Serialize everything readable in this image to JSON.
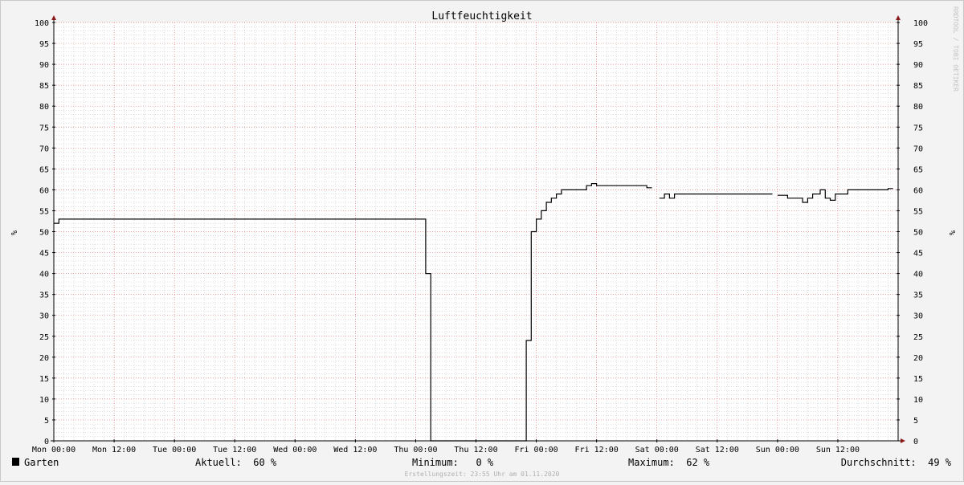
{
  "watermark": "RRDTOOL / TOBI OETIKER",
  "footer": "Erstellungszeit: 23:55 Uhr am 01.11.2020",
  "legend": {
    "series_name": "Garten",
    "current": "Aktuell:  60 %",
    "minimum": "Minimum:   0 %",
    "maximum": "Maximum:  62 %",
    "average": "Durchschnitt:  49 %"
  },
  "colors": {
    "line": "#000000",
    "major_grid": "#e07a7a",
    "minor_grid": "#bdbdbd",
    "background": "#ffffff",
    "canvas": "#f3f3f3",
    "axis_arrow": "#8b1a1a"
  },
  "chart_data": {
    "type": "line",
    "title": "Luftfeuchtigkeit",
    "ylabel": "%",
    "ylabel_right": "%",
    "xlabel": "",
    "ylim": [
      0,
      100
    ],
    "xlim": [
      0,
      168
    ],
    "x_unit": "hours since Mon 00:00",
    "grid": true,
    "legend_position": "bottom",
    "y_ticks": [
      0,
      5,
      10,
      15,
      20,
      25,
      30,
      35,
      40,
      45,
      50,
      55,
      60,
      65,
      70,
      75,
      80,
      85,
      90,
      95,
      100
    ],
    "x_ticks": [
      {
        "x": 0,
        "label": "Mon 00:00"
      },
      {
        "x": 12,
        "label": "Mon 12:00"
      },
      {
        "x": 24,
        "label": "Tue 00:00"
      },
      {
        "x": 36,
        "label": "Tue 12:00"
      },
      {
        "x": 48,
        "label": "Wed 00:00"
      },
      {
        "x": 60,
        "label": "Wed 12:00"
      },
      {
        "x": 72,
        "label": "Thu 00:00"
      },
      {
        "x": 84,
        "label": "Thu 12:00"
      },
      {
        "x": 96,
        "label": "Fri 00:00"
      },
      {
        "x": 108,
        "label": "Fri 12:00"
      },
      {
        "x": 120,
        "label": "Sat 00:00"
      },
      {
        "x": 132,
        "label": "Sat 12:00"
      },
      {
        "x": 144,
        "label": "Sun 00:00"
      },
      {
        "x": 156,
        "label": "Sun 12:00"
      }
    ],
    "series": [
      {
        "name": "Garten",
        "segments": [
          [
            [
              0,
              52
            ],
            [
              1,
              52
            ],
            [
              1,
              53
            ],
            [
              74,
              53
            ],
            [
              74,
              40
            ],
            [
              75,
              40
            ],
            [
              75,
              0
            ],
            [
              94,
              0
            ],
            [
              94,
              24
            ],
            [
              95,
              24
            ],
            [
              95,
              50
            ],
            [
              96,
              50
            ],
            [
              96,
              53
            ],
            [
              97,
              53
            ],
            [
              97,
              55
            ],
            [
              98,
              55
            ],
            [
              98,
              57
            ],
            [
              99,
              57
            ],
            [
              99,
              58
            ],
            [
              100,
              58
            ],
            [
              100,
              59
            ],
            [
              101,
              59
            ],
            [
              101,
              60
            ],
            [
              106,
              60
            ],
            [
              106,
              61
            ],
            [
              107,
              61
            ],
            [
              107,
              61.5
            ],
            [
              108,
              61.5
            ],
            [
              108,
              61
            ],
            [
              118,
              61
            ],
            [
              118,
              60.5
            ],
            [
              119,
              60.5
            ]
          ],
          [
            [
              120.5,
              58
            ],
            [
              121.5,
              58
            ],
            [
              121.5,
              59
            ],
            [
              122.5,
              59
            ],
            [
              122.5,
              58
            ],
            [
              123.5,
              58
            ],
            [
              123.5,
              59
            ],
            [
              143,
              59
            ]
          ],
          [
            [
              144,
              58.7
            ],
            [
              146,
              58.7
            ],
            [
              146,
              58
            ],
            [
              149,
              58
            ],
            [
              149,
              57
            ],
            [
              150,
              57
            ],
            [
              150,
              58
            ],
            [
              151,
              58
            ],
            [
              151,
              59
            ],
            [
              152.5,
              59
            ],
            [
              152.5,
              60
            ],
            [
              153.5,
              60
            ],
            [
              153.5,
              58
            ],
            [
              154.5,
              58
            ],
            [
              154.5,
              57.5
            ],
            [
              155.5,
              57.5
            ],
            [
              155.5,
              59
            ],
            [
              158,
              59
            ],
            [
              158,
              60
            ],
            [
              166,
              60
            ],
            [
              166,
              60.3
            ],
            [
              167,
              60.3
            ]
          ]
        ]
      }
    ]
  }
}
